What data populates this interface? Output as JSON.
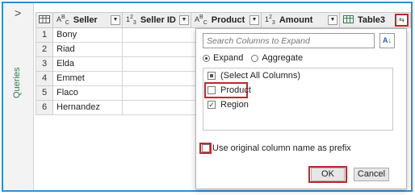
{
  "queries_pane": {
    "toggle_glyph": ">",
    "label": "Queries"
  },
  "columns": [
    {
      "type_icon": "table-icon",
      "name": ""
    },
    {
      "type_icon": "abc-icon",
      "type_text": "ABC",
      "name": "Seller"
    },
    {
      "type_icon": "number-icon",
      "type_text": "123",
      "name": "Seller ID"
    },
    {
      "type_icon": "abc-icon",
      "type_text": "ABC",
      "name": "Product"
    },
    {
      "type_icon": "number-icon",
      "type_text": "123",
      "name": "Amount"
    },
    {
      "type_icon": "table-icon",
      "name": "Table3"
    }
  ],
  "rows": [
    {
      "num": "1",
      "seller": "Bony"
    },
    {
      "num": "2",
      "seller": "Riad"
    },
    {
      "num": "3",
      "seller": "Elda"
    },
    {
      "num": "4",
      "seller": "Emmet"
    },
    {
      "num": "5",
      "seller": "Flaco"
    },
    {
      "num": "6",
      "seller": "Hernandez"
    }
  ],
  "expand_panel": {
    "search_placeholder": "Search Columns to Expand",
    "sort_icon": "sort-az-icon",
    "mode_expand": "Expand",
    "mode_aggregate": "Aggregate",
    "selected_mode": "Expand",
    "select_all": "(Select All Columns)",
    "items": [
      {
        "label": "Product",
        "checked": false
      },
      {
        "label": "Region",
        "checked": true
      }
    ],
    "prefix_label": "Use original column name as prefix",
    "prefix_checked": false,
    "ok_label": "OK",
    "cancel_label": "Cancel"
  },
  "colors": {
    "accent": "#2e8fd6",
    "highlight": "#c0282d",
    "queries_label": "#2a7c4f"
  }
}
